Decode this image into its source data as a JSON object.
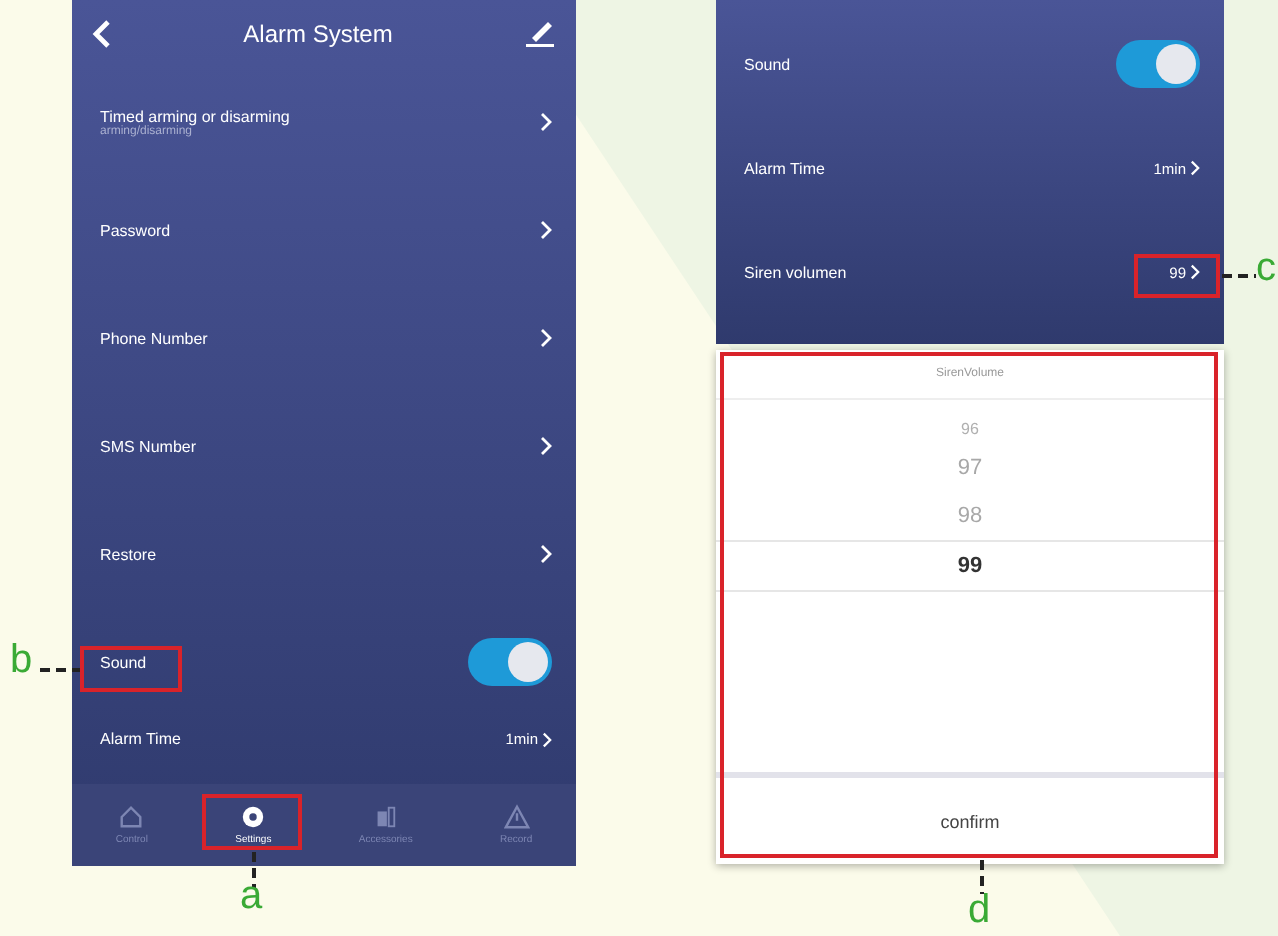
{
  "settings_screen": {
    "title": "Alarm System",
    "rows": [
      {
        "kind": "link",
        "label": "Timed arming or disarming",
        "sublabel": "arming/disarming"
      },
      {
        "kind": "link",
        "label": "Password"
      },
      {
        "kind": "link",
        "label": "Phone Number"
      },
      {
        "kind": "link",
        "label": "SMS Number"
      },
      {
        "kind": "link",
        "label": "Restore"
      },
      {
        "kind": "toggle",
        "label": "Sound",
        "on": true
      },
      {
        "kind": "value",
        "label": "Alarm Time",
        "value": "1min"
      }
    ],
    "tabs": [
      {
        "label": "Control",
        "selected": false
      },
      {
        "label": "Settings",
        "selected": true
      },
      {
        "label": "Accessories",
        "selected": false
      },
      {
        "label": "Record",
        "selected": false
      }
    ]
  },
  "sound_screen": {
    "rows": [
      {
        "kind": "toggle",
        "label": "Sound",
        "on": true
      },
      {
        "kind": "value",
        "label": "Alarm Time",
        "value": "1min"
      },
      {
        "kind": "value",
        "label": "Siren volumen",
        "value": "99"
      }
    ],
    "picker": {
      "title": "SirenVolume",
      "options": [
        {
          "label": "96",
          "selected": false
        },
        {
          "label": "97",
          "selected": false
        },
        {
          "label": "98",
          "selected": false
        },
        {
          "label": "99",
          "selected": true
        }
      ],
      "confirm": "confirm"
    }
  },
  "callouts": [
    {
      "label": "a"
    },
    {
      "label": "b"
    },
    {
      "label": "c"
    },
    {
      "label": "d"
    }
  ]
}
